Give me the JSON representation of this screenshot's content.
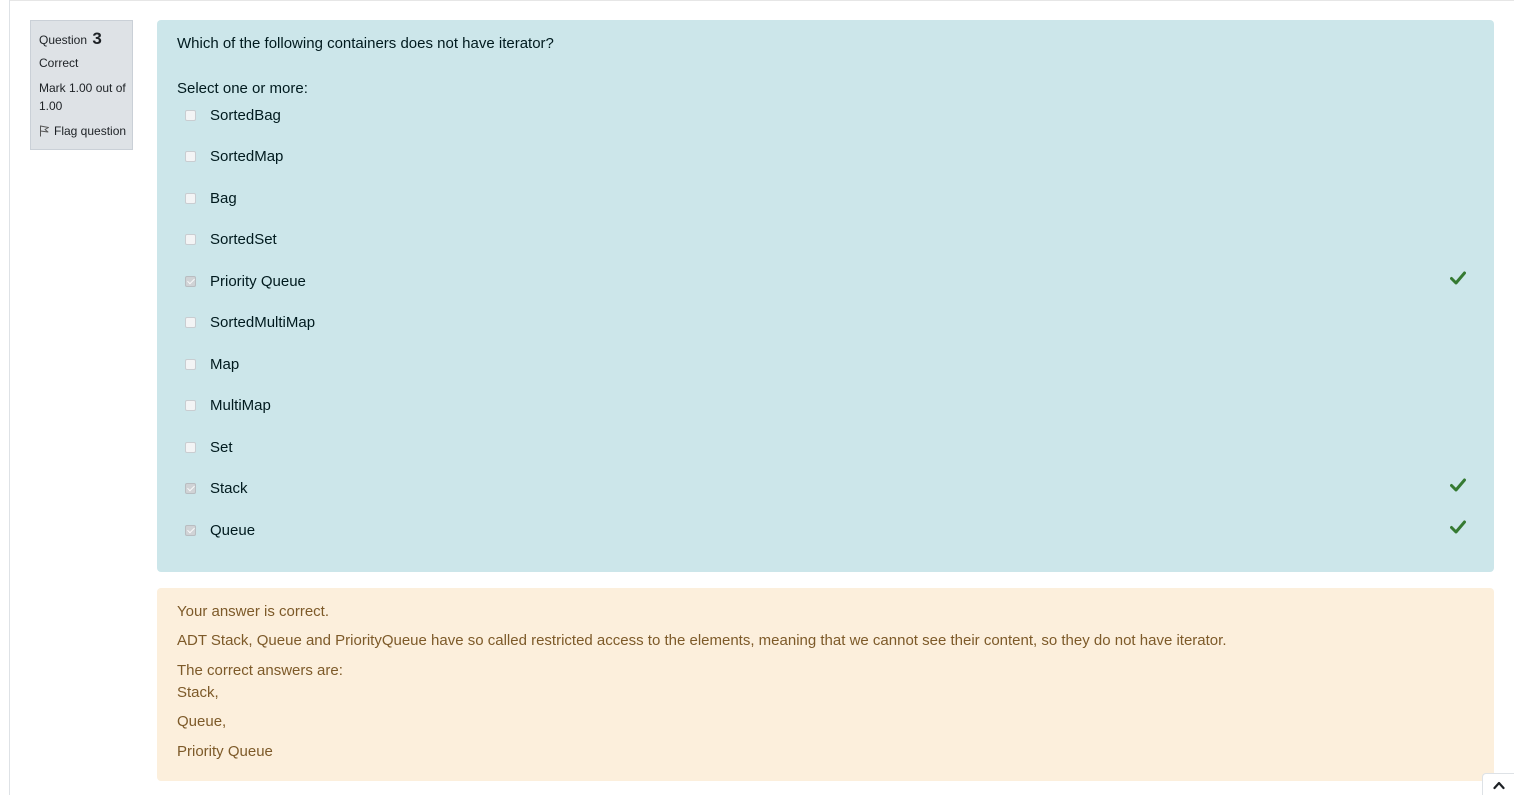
{
  "info": {
    "question_label": "Question",
    "question_number": "3",
    "state": "Correct",
    "grade": "Mark 1.00 out of 1.00",
    "flag_label": "Flag question"
  },
  "question": {
    "text": "Which of the following containers does not have iterator?",
    "prompt": "Select one or more:",
    "options": [
      {
        "label": "SortedBag",
        "checked": false,
        "correct_mark": false
      },
      {
        "label": "SortedMap",
        "checked": false,
        "correct_mark": false
      },
      {
        "label": "Bag",
        "checked": false,
        "correct_mark": false
      },
      {
        "label": "SortedSet",
        "checked": false,
        "correct_mark": false
      },
      {
        "label": "Priority Queue",
        "checked": true,
        "correct_mark": true
      },
      {
        "label": "SortedMultiMap",
        "checked": false,
        "correct_mark": false
      },
      {
        "label": "Map",
        "checked": false,
        "correct_mark": false
      },
      {
        "label": "MultiMap",
        "checked": false,
        "correct_mark": false
      },
      {
        "label": "Set",
        "checked": false,
        "correct_mark": false
      },
      {
        "label": "Stack",
        "checked": true,
        "correct_mark": true
      },
      {
        "label": "Queue",
        "checked": true,
        "correct_mark": true
      }
    ]
  },
  "feedback": {
    "result": "Your answer is correct.",
    "explanation": "ADT Stack, Queue and PriorityQueue have so called restricted access to the elements, meaning that we cannot see their content, so they do not have iterator.",
    "correct_heading": "The correct answers are:",
    "correct_answers": [
      "Stack,",
      "Queue,",
      "Priority Queue"
    ]
  },
  "colors": {
    "formulation_bg": "#cce6ea",
    "feedback_bg": "#fcefdc",
    "feedback_text": "#7d5a29",
    "tick": "#357a32",
    "info_bg": "#dee2e6"
  },
  "icons": {
    "flag": "flag-icon",
    "tick": "check-icon",
    "scroll": "chevron-up-icon"
  }
}
